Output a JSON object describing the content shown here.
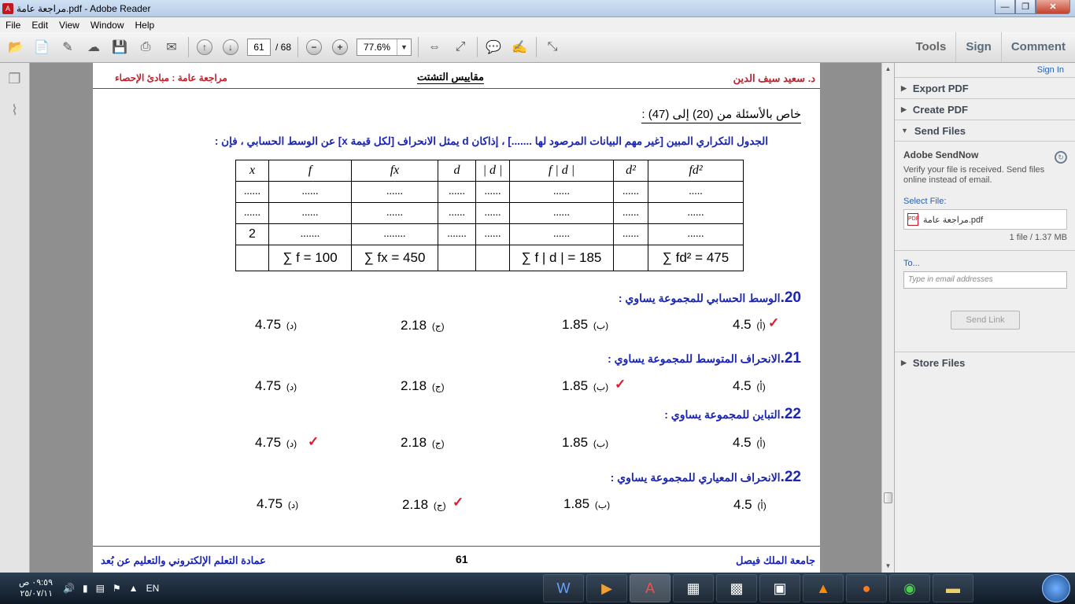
{
  "window": {
    "title": "مراجعة عامة.pdf - Adobe Reader",
    "min": "—",
    "max": "❐",
    "close": "✕"
  },
  "menu": [
    "File",
    "Edit",
    "View",
    "Window",
    "Help"
  ],
  "toolbar": {
    "page_current": "61",
    "page_total": "/ 68",
    "zoom": "77.6%",
    "tools": "Tools",
    "sign": "Sign",
    "comment": "Comment"
  },
  "panel": {
    "sign_in": "Sign In",
    "export_pdf": "Export PDF",
    "create_pdf": "Create PDF",
    "send_files": "Send Files",
    "sendnow_title": "Adobe SendNow",
    "sendnow_desc": "Verify your file is received. Send files online instead of email.",
    "select_file": "Select File:",
    "file_name": "مراجعة عامة.pdf",
    "file_size": "1 file / 1.37 MB",
    "to_label": "To...",
    "to_placeholder": "Type in email addresses",
    "send_link": "Send Link",
    "store_files": "Store Files"
  },
  "doc": {
    "header_right": "د. سعيد سيف الدين",
    "header_center": "مقاييس التشتت",
    "header_left": "مراجعة عامة : مبادئ الإحصاء",
    "subheading": "خاص بالأسئلة من (20) إلى (47) :",
    "intro": "الجدول التكراري المبين [غير مهم البيانات المرصود لها .......] ، إذاكان d يمثل الانحراف [لكل قيمة x] عن الوسط الحسابي ، فإن :",
    "table": {
      "headers": [
        "x",
        "f",
        "fx",
        "d",
        "| d |",
        "f | d |",
        "d²",
        "fd²"
      ],
      "rows": [
        [
          "......",
          "......",
          "......",
          "......",
          "......",
          "......",
          "......",
          "....."
        ],
        [
          "......",
          "......",
          "......",
          "......",
          "......",
          "......",
          "......",
          "......"
        ],
        [
          "2",
          ".......",
          "........",
          ".......",
          "......",
          "......",
          "......",
          "......"
        ]
      ],
      "sums": [
        "",
        "∑ f = 100",
        "∑ fx = 450",
        "",
        "",
        "∑ f | d | = 185",
        "",
        "∑ fd² = 475"
      ]
    },
    "questions": [
      {
        "num": "20.",
        "text": "الوسط الحسابي للمجموعة يساوي :",
        "a": "4.5",
        "b": "1.85",
        "c": "2.18",
        "d": "4.75"
      },
      {
        "num": "21.",
        "text": "الانحراف المتوسط للمجموعة يساوي :",
        "a": "4.5",
        "b": "1.85",
        "c": "2.18",
        "d": "4.75"
      },
      {
        "num": "22.",
        "text": "التباين للمجموعة يساوي :",
        "a": "4.5",
        "b": "1.85",
        "c": "2.18",
        "d": "4.75"
      },
      {
        "num": "22.",
        "text": "الانحراف المعياري للمجموعة يساوي :",
        "a": "4.5",
        "b": "1.85",
        "c": "2.18",
        "d": "4.75"
      }
    ],
    "letters": {
      "a": "(أ)",
      "b": "(ب)",
      "c": "(ج)",
      "d": "(د)"
    },
    "tick": "✓",
    "footer_right": "جامعة الملك فيصل",
    "footer_center": "61",
    "footer_left": "عمادة التعلم الإلكتروني والتعليم عن بُعد"
  },
  "taskbar": {
    "time": "٠٩:٥٩ ص",
    "date": "٢٥/٠٧/١١",
    "lang": "EN"
  }
}
